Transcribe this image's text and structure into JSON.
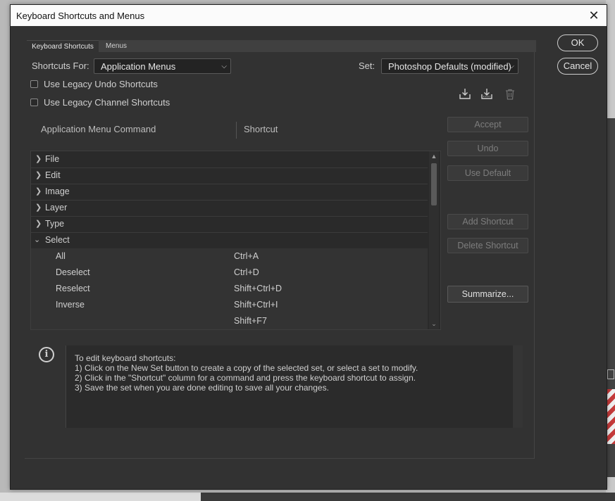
{
  "window": {
    "title": "Keyboard Shortcuts and Menus",
    "close_glyph": "✕"
  },
  "tabs": [
    {
      "label": "Keyboard Shortcuts"
    },
    {
      "label": "Menus"
    }
  ],
  "shortcuts_for": {
    "label": "Shortcuts For:",
    "value": "Application Menus"
  },
  "set": {
    "label": "Set:",
    "value": "Photoshop Defaults (modified)"
  },
  "options": [
    {
      "label": "Use Legacy Undo Shortcuts",
      "checked": false
    },
    {
      "label": "Use Legacy Channel Shortcuts",
      "checked": false
    }
  ],
  "icons": [
    "save-set-icon",
    "new-set-icon",
    "delete-set-icon",
    "info-icon"
  ],
  "columns": {
    "command": "Application Menu Command",
    "shortcut": "Shortcut"
  },
  "categories": [
    {
      "label": "File",
      "expanded": false
    },
    {
      "label": "Edit",
      "expanded": false
    },
    {
      "label": "Image",
      "expanded": false
    },
    {
      "label": "Layer",
      "expanded": false
    },
    {
      "label": "Type",
      "expanded": false
    },
    {
      "label": "Select",
      "expanded": true
    }
  ],
  "select_items": [
    {
      "command": "All",
      "shortcut": "Ctrl+A"
    },
    {
      "command": "Deselect",
      "shortcut": "Ctrl+D"
    },
    {
      "command": "Reselect",
      "shortcut": "Shift+Ctrl+D"
    },
    {
      "command": "Inverse",
      "shortcut": "Shift+Ctrl+I"
    },
    {
      "command": "",
      "shortcut": "Shift+F7"
    }
  ],
  "buttons": {
    "accept": "Accept",
    "undo": "Undo",
    "use_default": "Use Default",
    "add_shortcut": "Add Shortcut",
    "delete_shortcut": "Delete Shortcut",
    "summarize": "Summarize...",
    "ok": "OK",
    "cancel": "Cancel"
  },
  "info": {
    "lines": [
      "To edit keyboard shortcuts:",
      "1) Click on the New Set button to create a copy of the selected set, or select a set to modify.",
      "2) Click in the \"Shortcut\" column for a command and press the keyboard shortcut to assign.",
      "3) Save the set when you are done editing to save all your changes."
    ]
  },
  "colors": {
    "dialog_bg": "#323232",
    "titlebar_bg": "#fbfbfb",
    "list_bg": "#2a2a2a"
  }
}
